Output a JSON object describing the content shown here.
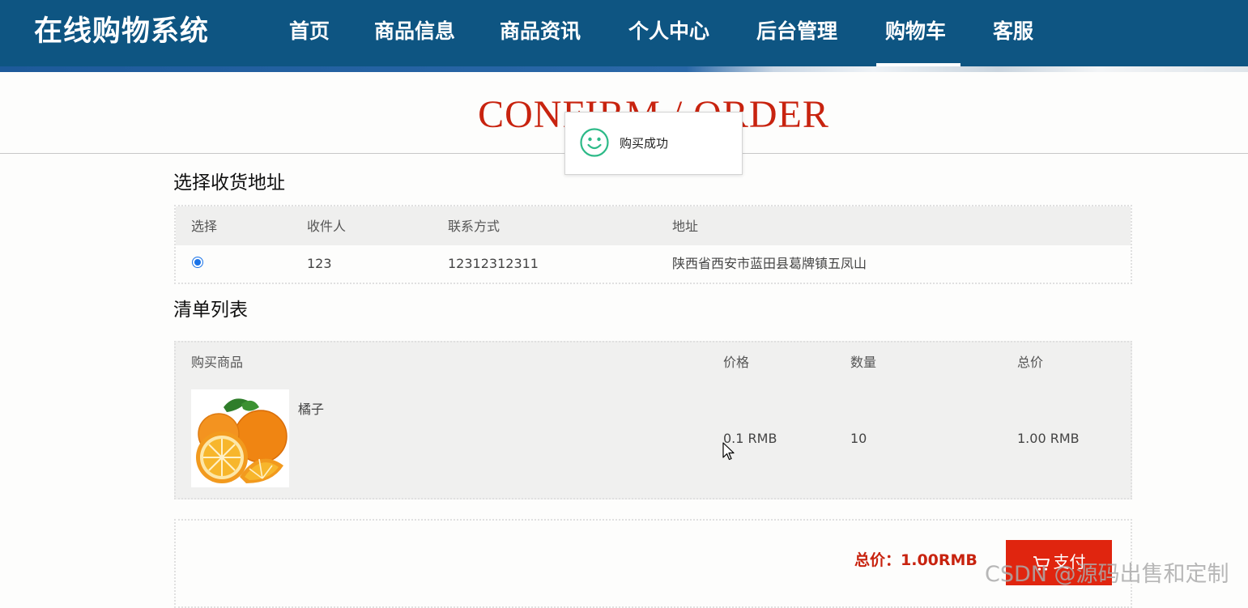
{
  "header": {
    "brand": "在线购物系统",
    "nav": [
      "首页",
      "商品信息",
      "商品资讯",
      "个人中心",
      "后台管理",
      "购物车",
      "客服"
    ],
    "active": "购物车"
  },
  "hero": {
    "title": "CONFIRM / ORDER"
  },
  "toast": {
    "icon": "smile-icon",
    "message": "购买成功"
  },
  "address": {
    "title": "选择收货地址",
    "headers": [
      "选择",
      "收件人",
      "联系方式",
      "地址"
    ],
    "rows": [
      {
        "selected": true,
        "recipient": "123",
        "phone": "12312312311",
        "address": "陕西省西安市蓝田县葛牌镇五凤山"
      }
    ]
  },
  "cart": {
    "title": "清单列表",
    "headers": [
      "购买商品",
      "价格",
      "数量",
      "总价"
    ],
    "items": [
      {
        "image": "orange-image",
        "name": "橘子",
        "price": "0.1 RMB",
        "quantity": "10",
        "total": "1.00 RMB"
      }
    ]
  },
  "summary": {
    "total_label": "总价：1.00RMB",
    "pay_label": "支付",
    "pay_icon": "cart-icon"
  },
  "watermark": "CSDN @源码出售和定制",
  "colors": {
    "nav_bg": "#0e5582",
    "accent_red": "#c8230f",
    "pay_button": "#e0250f",
    "toast_icon": "#2dba88"
  }
}
